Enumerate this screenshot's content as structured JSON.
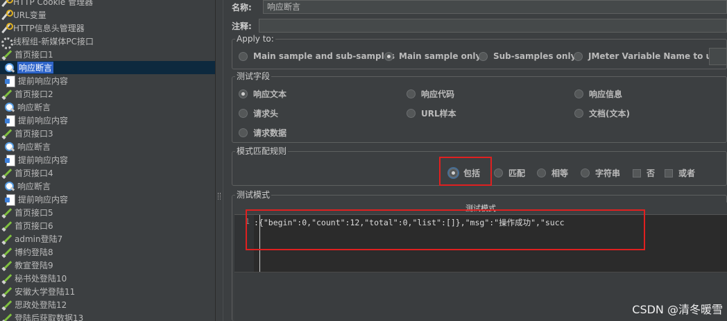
{
  "tree": {
    "nodes": [
      {
        "label": "HTTP Cookie 管理器",
        "icon": "wrench-icon"
      },
      {
        "label": "URL变量",
        "icon": "wrench-icon"
      },
      {
        "label": "HTTP信息头管理器",
        "icon": "wrench-icon"
      },
      {
        "label": "线程组-新媒体PC接口",
        "icon": "gear-icon"
      },
      {
        "label": "首页接口1",
        "icon": "pipette-icon"
      },
      {
        "label": "响应断言",
        "icon": "magnifier-icon",
        "selected": true
      },
      {
        "label": "提前响应内容",
        "icon": "doc-icon"
      },
      {
        "label": "首页接口2",
        "icon": "pipette-icon"
      },
      {
        "label": "响应断言",
        "icon": "magnifier-icon"
      },
      {
        "label": "提前响应内容",
        "icon": "doc-icon"
      },
      {
        "label": "首页接口3",
        "icon": "pipette-icon"
      },
      {
        "label": "响应断言",
        "icon": "magnifier-icon"
      },
      {
        "label": "提前响应内容",
        "icon": "doc-icon"
      },
      {
        "label": "首页接口4",
        "icon": "pipette-icon"
      },
      {
        "label": "响应断言",
        "icon": "magnifier-icon"
      },
      {
        "label": "提前响应内容",
        "icon": "doc-icon"
      },
      {
        "label": "首页接口5",
        "icon": "pipette-icon"
      },
      {
        "label": "首页接口6",
        "icon": "pipette-icon"
      },
      {
        "label": "admin登陆7",
        "icon": "pipette-icon"
      },
      {
        "label": "博约登陆8",
        "icon": "pipette-icon"
      },
      {
        "label": "教宣登陆9",
        "icon": "pipette-icon"
      },
      {
        "label": "秘书处登陆10",
        "icon": "pipette-icon"
      },
      {
        "label": "安徽大学登陆11",
        "icon": "pipette-icon"
      },
      {
        "label": "思政处登陆12",
        "icon": "pipette-icon"
      },
      {
        "label": "登陆后获取数据13",
        "icon": "pipette-icon"
      }
    ]
  },
  "form": {
    "name_label": "名称:",
    "name_value": "响应断言",
    "comment_label": "注释:",
    "comment_value": ""
  },
  "apply_to": {
    "title": "Apply to:",
    "options": [
      {
        "label": "Main sample and sub-samples",
        "checked": false
      },
      {
        "label": "Main sample only",
        "checked": true
      },
      {
        "label": "Sub-samples only",
        "checked": false
      },
      {
        "label": "JMeter Variable Name to use",
        "checked": false
      }
    ]
  },
  "test_field": {
    "title": "测试字段",
    "options": [
      {
        "label": "响应文本",
        "checked": true
      },
      {
        "label": "响应代码",
        "checked": false
      },
      {
        "label": "响应信息",
        "checked": false
      },
      {
        "label": "请求头",
        "checked": false
      },
      {
        "label": "URL样本",
        "checked": false
      },
      {
        "label": "文档(文本)",
        "checked": false
      },
      {
        "label": "请求数据",
        "checked": false
      }
    ]
  },
  "match_rule": {
    "title": "模式匹配规则",
    "radios": [
      {
        "label": "包括",
        "checked": true
      },
      {
        "label": "匹配",
        "checked": false
      },
      {
        "label": "相等",
        "checked": false
      },
      {
        "label": "字符串",
        "checked": false
      }
    ],
    "checks": [
      {
        "label": "否",
        "checked": false
      },
      {
        "label": "或者",
        "checked": false
      }
    ]
  },
  "test_pattern": {
    "title": "测试模式",
    "header": "测试模式",
    "line_number": "1",
    "code": ":{\"begin\":0,\"count\":12,\"total\":0,\"list\":[]},\"msg\":\"操作成功\",\"succ"
  },
  "watermark": "CSDN @清冬暖雪",
  "colors": {
    "annotation": "#e02020",
    "selection": "#2f65ca"
  }
}
